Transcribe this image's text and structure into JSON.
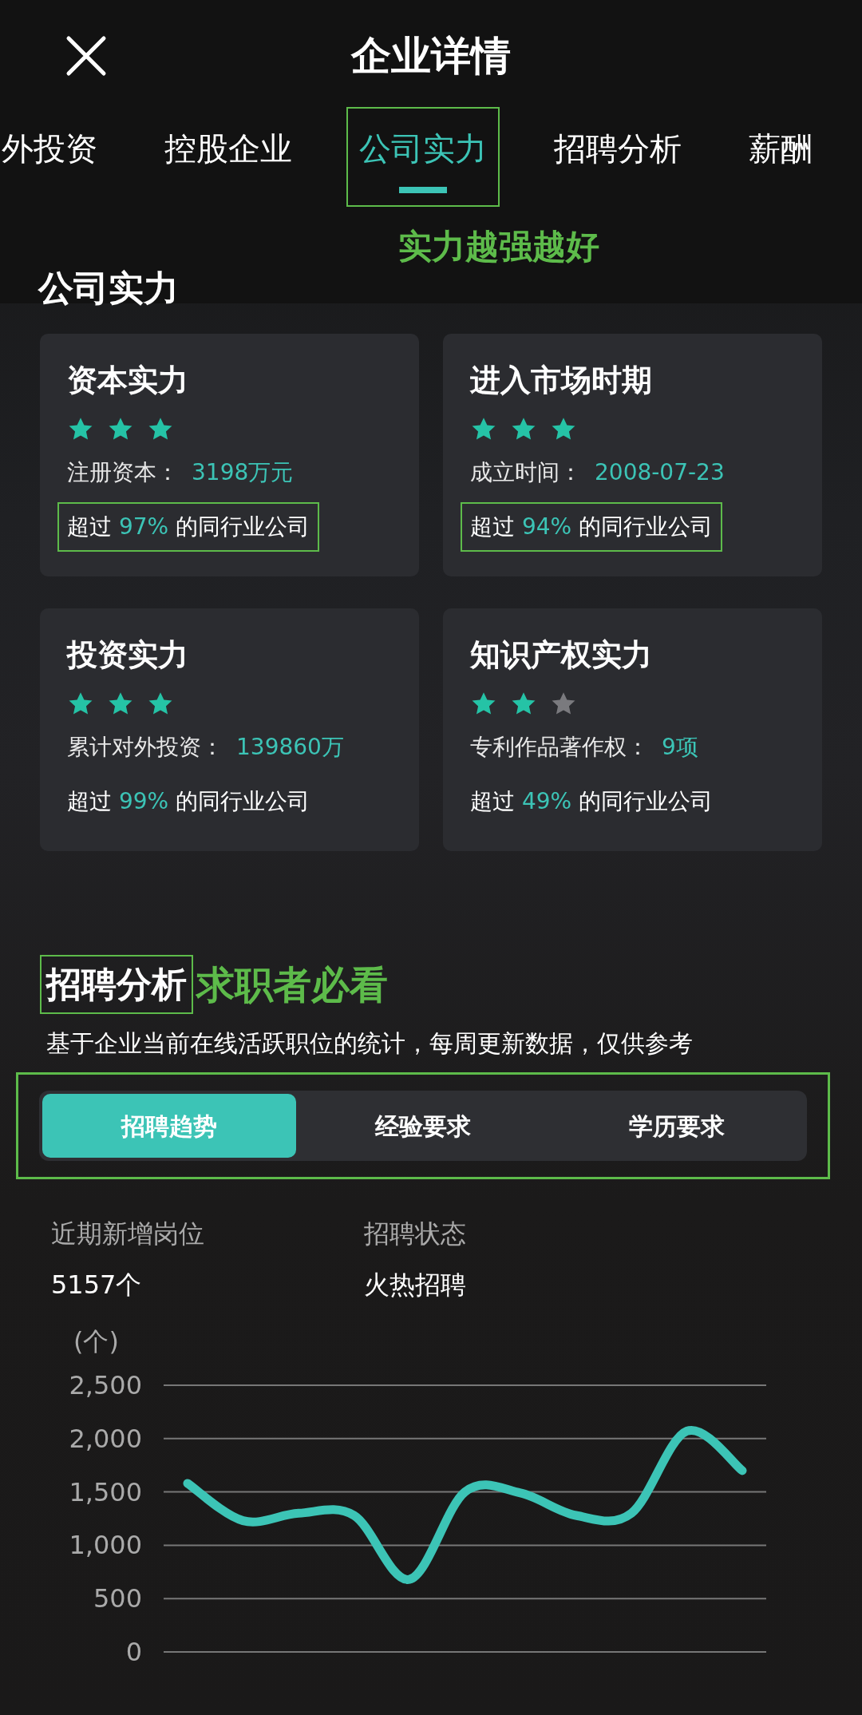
{
  "header": {
    "title": "企业详情"
  },
  "tabs": [
    {
      "label": "外投资",
      "selected": false,
      "annotated": false
    },
    {
      "label": "控股企业",
      "selected": false,
      "annotated": false
    },
    {
      "label": "公司实力",
      "selected": true,
      "annotated": true
    },
    {
      "label": "招聘分析",
      "selected": false,
      "annotated": false
    },
    {
      "label": "薪酬",
      "selected": false,
      "annotated": false
    }
  ],
  "tab_note": "实力越强越好",
  "strength": {
    "title": "公司实力",
    "cards": [
      {
        "title": "资本实力",
        "stars": 3,
        "label": "注册资本：",
        "value": "3198万元",
        "compare": "超过 **97%** 的同行业公司",
        "annotated": true
      },
      {
        "title": "进入市场时期",
        "stars": 3,
        "label": "成立时间：",
        "value": "2008-07-23",
        "compare": "超过 **94%** 的同行业公司",
        "annotated": true
      },
      {
        "title": "投资实力",
        "stars": 3,
        "label": "累计对外投资：",
        "value": "139860万",
        "compare": "超过 **99%** 的同行业公司",
        "annotated": false
      },
      {
        "title": "知识产权实力",
        "stars": 2,
        "label": "专利作品著作权：",
        "value": "9项",
        "compare": "超过 **49%** 的同行业公司",
        "annotated": false
      }
    ]
  },
  "recruit": {
    "title": "招聘分析",
    "title_annotated": true,
    "note": "求职者必看",
    "description": "基于企业当前在线活跃职位的统计，每周更新数据，仅供参考",
    "segments_annotated": true,
    "segments": [
      {
        "label": "招聘趋势",
        "selected": true
      },
      {
        "label": "经验要求",
        "selected": false
      },
      {
        "label": "学历要求",
        "selected": false
      }
    ],
    "stats": [
      {
        "label": "近期新增岗位",
        "value": "5157个"
      },
      {
        "label": "招聘状态",
        "value": "火热招聘"
      }
    ],
    "chart_data": {
      "type": "line",
      "ylabel": "(个)",
      "ylim": [
        0,
        2500
      ],
      "yticks": [
        {
          "value": 0,
          "label": "0"
        },
        {
          "value": 500,
          "label": "500"
        },
        {
          "value": 1000,
          "label": "1,000"
        },
        {
          "value": 1500,
          "label": "1,500"
        },
        {
          "value": 2000,
          "label": "2,000"
        },
        {
          "value": 2500,
          "label": "2,500"
        }
      ],
      "grid": true,
      "series": [
        {
          "color": "#3cc4b6",
          "values": [
            1580,
            1230,
            1300,
            1280,
            680,
            1500,
            1490,
            1280,
            1300,
            2070,
            1700
          ]
        }
      ]
    }
  }
}
